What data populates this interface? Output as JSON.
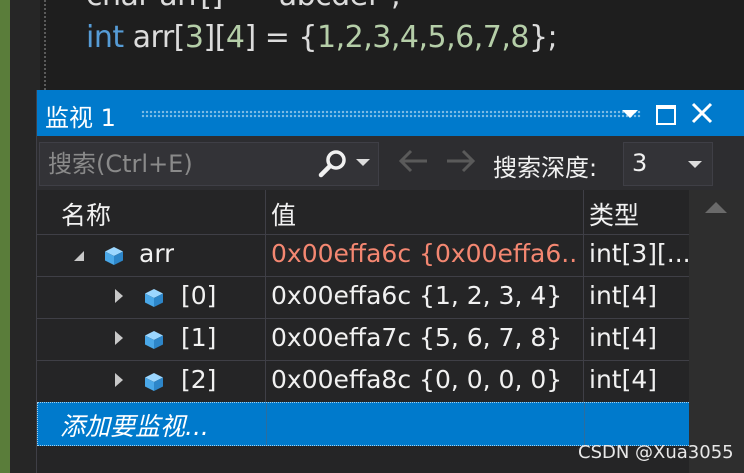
{
  "editor": {
    "prev_line": "char arr[] = \"abcdef\";",
    "code_keyword": "int",
    "code_rest_before": " arr[",
    "code_n1": "3",
    "code_mid": "][",
    "code_n2": "4",
    "code_rest_after": "] = {",
    "code_values": "1,2,3,4,5,6,7,8",
    "code_end": "};"
  },
  "watch": {
    "title": "监视 1",
    "search_placeholder": "搜索(Ctrl+E)",
    "depth_label": "搜索深度:",
    "depth_value": "3",
    "columns": [
      "名称",
      "值",
      "类型"
    ],
    "rows": [
      {
        "name": "arr",
        "value": "0x00effa6c {0x00effa6...",
        "type": "int[3][..."
      },
      {
        "name": "[0]",
        "value": "0x00effa6c {1, 2, 3, 4}",
        "type": "int[4]"
      },
      {
        "name": "[1]",
        "value": "0x00effa7c {5, 6, 7, 8}",
        "type": "int[4]"
      },
      {
        "name": "[2]",
        "value": "0x00effa8c {0, 0, 0, 0}",
        "type": "int[4]"
      }
    ],
    "add_item": "添加要监视..."
  },
  "watermark": "CSDN @Xua3055",
  "colors": {
    "accent": "#007acc",
    "value_changed": "#f48771",
    "keyword": "#569cd6"
  }
}
